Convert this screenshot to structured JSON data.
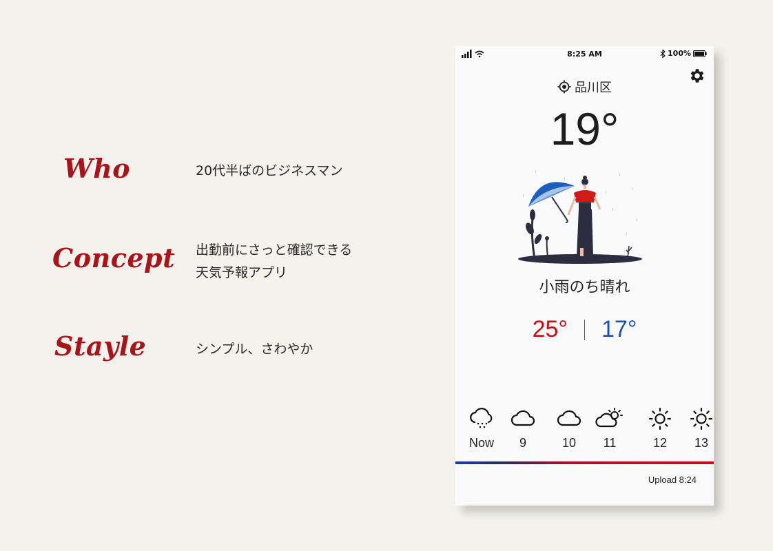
{
  "persona": [
    {
      "label": "Who",
      "text": "20代半ばのビジネスマン"
    },
    {
      "label": "Concept",
      "text_line1": "出勤前にさっと確認できる",
      "text_line2": "天気予報アプリ"
    },
    {
      "label": "Stayle",
      "text": "シンプル、さわやか"
    }
  ],
  "status_bar": {
    "time": "8:25 AM",
    "battery": "100%"
  },
  "location": {
    "name": "品川区",
    "icon": "location-target-icon"
  },
  "weather": {
    "temperature": "19°",
    "condition": "小雨のち晴れ",
    "high": "25°",
    "low": "17°"
  },
  "hourly": [
    {
      "label": "Now",
      "icon": "snow-cloud-icon"
    },
    {
      "label": "9",
      "icon": "cloud-icon"
    },
    {
      "label": "10",
      "icon": "cloud-icon"
    },
    {
      "label": "11",
      "icon": "partly-sunny-icon"
    },
    {
      "label": "12",
      "icon": "sun-icon"
    },
    {
      "label": "13",
      "icon": "sun-icon"
    }
  ],
  "update_text": "Upload 8:24",
  "colors": {
    "accent_red": "#c41016",
    "accent_blue": "#1a52b5",
    "label_red": "#a8141a",
    "background": "#f3f2ed"
  }
}
